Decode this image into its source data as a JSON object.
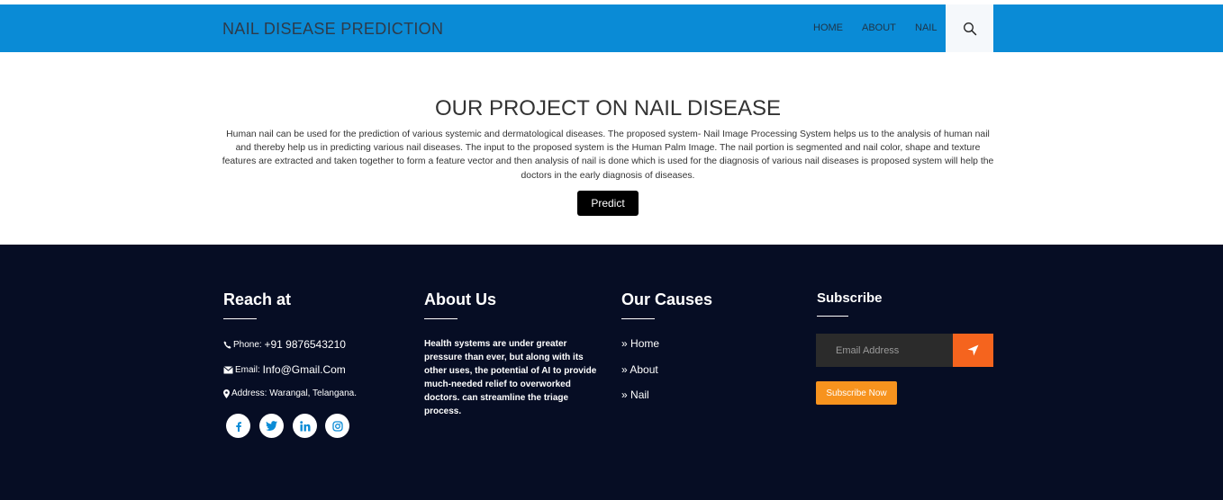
{
  "header": {
    "brand": "NAIL DISEASE PREDICTION",
    "nav": [
      {
        "label": "HOME"
      },
      {
        "label": "ABOUT"
      },
      {
        "label": "NAIL"
      }
    ],
    "search_icon": "search-icon"
  },
  "main": {
    "title": "OUR PROJECT ON NAIL DISEASE",
    "description": "Human nail can be used for the prediction of various systemic and dermatological diseases. The proposed system- Nail Image Processing System helps us to the analysis of human nail and thereby help us in predicting various nail diseases. The input to the proposed system is the Human Palm Image. The nail portion is segmented and nail color, shape and texture features are extracted and taken together to form a feature vector and then analysis of nail is done which is used for the diagnosis of various nail diseases is proposed system will help the doctors in the early diagnosis of diseases.",
    "predict_label": "Predict"
  },
  "footer": {
    "reach": {
      "heading": "Reach at",
      "phone_label": "Phone:",
      "phone": "+91 9876543210",
      "email_label": "Email:",
      "email": "Info@Gmail.Com",
      "address_label": "Address:",
      "address": "Warangal, Telangana.",
      "social": [
        "facebook-icon",
        "twitter-icon",
        "linkedin-icon",
        "instagram-icon"
      ]
    },
    "about": {
      "heading": "About Us",
      "text": "Health systems are under greater pressure than ever, but along with its other uses, the potential of AI to provide much-needed relief to overworked doctors. can streamline the triage process."
    },
    "causes": {
      "heading": "Our Causes",
      "links": [
        {
          "label": "Home"
        },
        {
          "label": "About"
        },
        {
          "label": "Nail"
        }
      ]
    },
    "subscribe": {
      "heading": "Subscribe",
      "placeholder": "Email Address",
      "button_label": "Subscribe Now"
    }
  },
  "colors": {
    "navbar": "#0a8bd6",
    "footer": "#060d24",
    "send_button": "#f5641e",
    "subscribe_button": "#f7931e",
    "social_icon": "#0a8bd6"
  }
}
